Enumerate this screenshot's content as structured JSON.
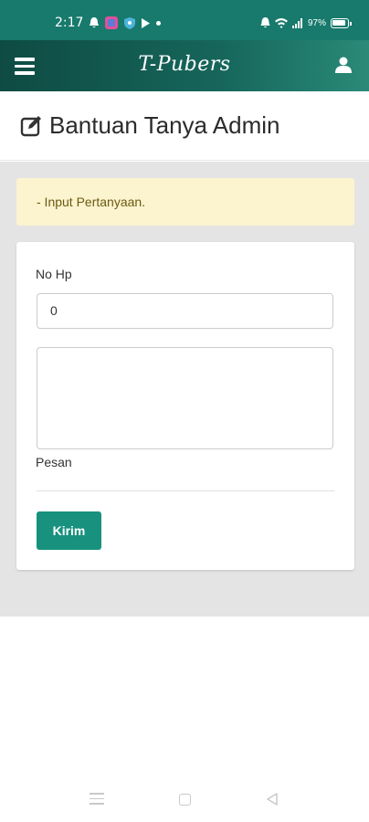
{
  "status_bar": {
    "time": "2:17",
    "battery": "97%"
  },
  "navbar": {
    "brand": "T-Pubers",
    "icons": [
      "menu-icon",
      "user-icon"
    ]
  },
  "page": {
    "title": "Bantuan Tanya Admin",
    "title_icon": "edit-icon"
  },
  "alert": {
    "text": "- Input Pertanyaan.",
    "background": "#fcf3cf"
  },
  "form": {
    "phone_label": "No Hp",
    "phone_value": "0",
    "message_label": "Pesan",
    "message_value": "",
    "submit_label": "Kirim"
  },
  "colors": {
    "primary": "#18917e",
    "navbar_dark": "#0e4b43",
    "status_bar": "#177a6c"
  },
  "system_nav": {
    "icons": [
      "recents-icon",
      "home-icon",
      "back-icon"
    ]
  }
}
